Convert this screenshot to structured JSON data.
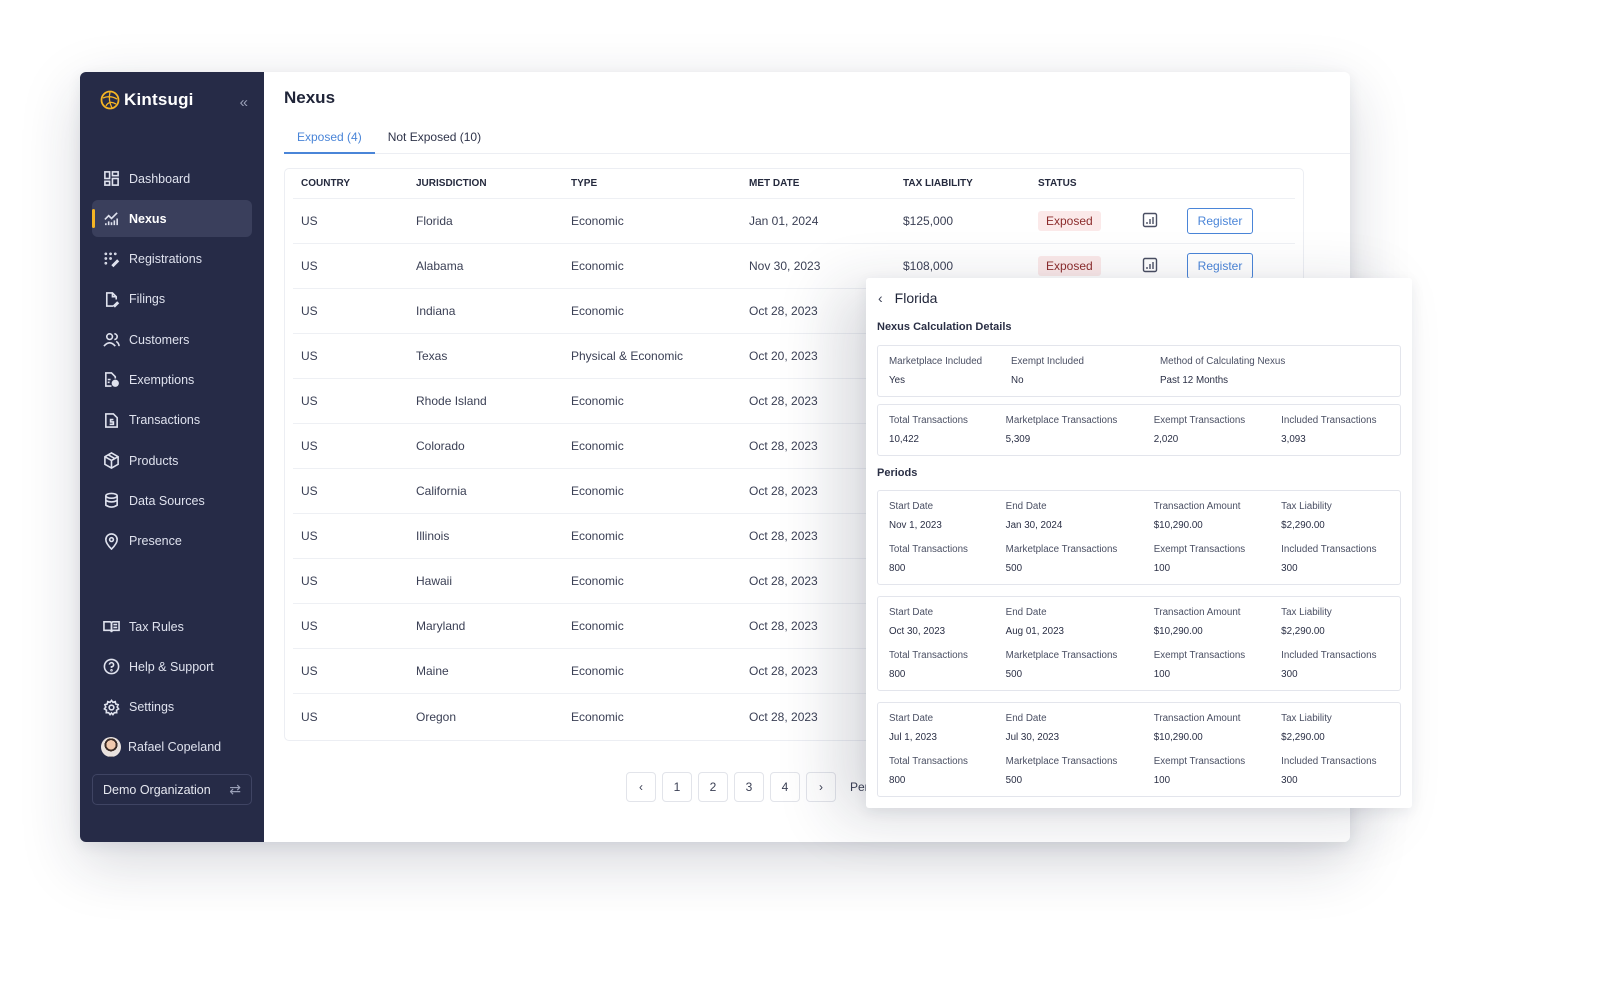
{
  "app": {
    "brand": "Kintsugi",
    "accent_color": "#4a85d8",
    "sidebar_color": "#262b47",
    "active_indicator_color": "#f5b524"
  },
  "sidebar": {
    "items": [
      {
        "label": "Dashboard",
        "icon": "dashboard-icon"
      },
      {
        "label": "Nexus",
        "icon": "nexus-chart-icon",
        "active": true
      },
      {
        "label": "Registrations",
        "icon": "registrations-icon"
      },
      {
        "label": "Filings",
        "icon": "filings-icon"
      },
      {
        "label": "Customers",
        "icon": "customers-icon"
      },
      {
        "label": "Exemptions",
        "icon": "exemptions-icon"
      },
      {
        "label": "Transactions",
        "icon": "transactions-icon"
      },
      {
        "label": "Products",
        "icon": "products-icon"
      },
      {
        "label": "Data Sources",
        "icon": "database-icon"
      },
      {
        "label": "Presence",
        "icon": "location-pin-icon"
      }
    ],
    "bottom_items": [
      {
        "label": "Tax Rules",
        "icon": "book-icon"
      },
      {
        "label": "Help & Support",
        "icon": "help-icon"
      },
      {
        "label": "Settings",
        "icon": "gear-icon"
      }
    ],
    "user_name": "Rafael Copeland",
    "organization": "Demo Organization"
  },
  "main": {
    "title": "Nexus",
    "tabs": [
      {
        "label": "Exposed (4)",
        "active": true
      },
      {
        "label": "Not Exposed (10)",
        "active": false
      }
    ],
    "table": {
      "columns": [
        "COUNTRY",
        "JURISDICTION",
        "TYPE",
        "MET DATE",
        "TAX LIABILITY",
        "STATUS"
      ],
      "rows": [
        {
          "country": "US",
          "jurisdiction": "Florida",
          "type": "Economic",
          "met_date": "Jan 01, 2024",
          "tax_liability": "$125,000",
          "status": "Exposed",
          "action": "Register"
        },
        {
          "country": "US",
          "jurisdiction": "Alabama",
          "type": "Economic",
          "met_date": "Nov 30, 2023",
          "tax_liability": "$108,000",
          "status": "Exposed",
          "action": "Register"
        },
        {
          "country": "US",
          "jurisdiction": "Indiana",
          "type": "Economic",
          "met_date": "Oct 28, 2023"
        },
        {
          "country": "US",
          "jurisdiction": "Texas",
          "type": "Physical & Economic",
          "met_date": "Oct 20, 2023"
        },
        {
          "country": "US",
          "jurisdiction": "Rhode Island",
          "type": "Economic",
          "met_date": "Oct 28, 2023"
        },
        {
          "country": "US",
          "jurisdiction": "Colorado",
          "type": "Economic",
          "met_date": "Oct 28, 2023"
        },
        {
          "country": "US",
          "jurisdiction": "California",
          "type": "Economic",
          "met_date": "Oct 28, 2023"
        },
        {
          "country": "US",
          "jurisdiction": "Illinois",
          "type": "Economic",
          "met_date": "Oct 28, 2023"
        },
        {
          "country": "US",
          "jurisdiction": "Hawaii",
          "type": "Economic",
          "met_date": "Oct 28, 2023"
        },
        {
          "country": "US",
          "jurisdiction": "Maryland",
          "type": "Economic",
          "met_date": "Oct 28, 2023"
        },
        {
          "country": "US",
          "jurisdiction": "Maine",
          "type": "Economic",
          "met_date": "Oct 28, 2023"
        },
        {
          "country": "US",
          "jurisdiction": "Oregon",
          "type": "Economic",
          "met_date": "Oct 28, 2023"
        }
      ]
    },
    "pagination": {
      "pages": [
        "1",
        "2",
        "3",
        "4"
      ],
      "prev": "‹",
      "next": "›",
      "per_page_label": "Per"
    }
  },
  "detail": {
    "title": "Florida",
    "back": "‹",
    "calc_section": "Nexus Calculation Details",
    "settings": {
      "labels": [
        "Marketplace Included",
        "Exempt Included",
        "Method of Calculating Nexus"
      ],
      "values": [
        "Yes",
        "No",
        "Past 12 Months"
      ]
    },
    "totals": {
      "labels": [
        "Total Transactions",
        "Marketplace Transactions",
        "Exempt Transactions",
        "Included Transactions"
      ],
      "values": [
        "10,422",
        "5,309",
        "2,020",
        "3,093"
      ]
    },
    "periods_section": "Periods",
    "period_labels_top": [
      "Start Date",
      "End Date",
      "Transaction Amount",
      "Tax Liability"
    ],
    "period_labels_bottom": [
      "Total Transactions",
      "Marketplace Transactions",
      "Exempt Transactions",
      "Included Transactions"
    ],
    "periods": [
      {
        "top": [
          "Nov 1, 2023",
          "Jan 30, 2024",
          "$10,290.00",
          "$2,290.00"
        ],
        "bottom": [
          "800",
          "500",
          "100",
          "300"
        ]
      },
      {
        "top": [
          "Oct 30, 2023",
          "Aug 01, 2023",
          "$10,290.00",
          "$2,290.00"
        ],
        "bottom": [
          "800",
          "500",
          "100",
          "300"
        ]
      },
      {
        "top": [
          "Jul 1, 2023",
          "Jul 30, 2023",
          "$10,290.00",
          "$2,290.00"
        ],
        "bottom": [
          "800",
          "500",
          "100",
          "300"
        ]
      }
    ]
  }
}
